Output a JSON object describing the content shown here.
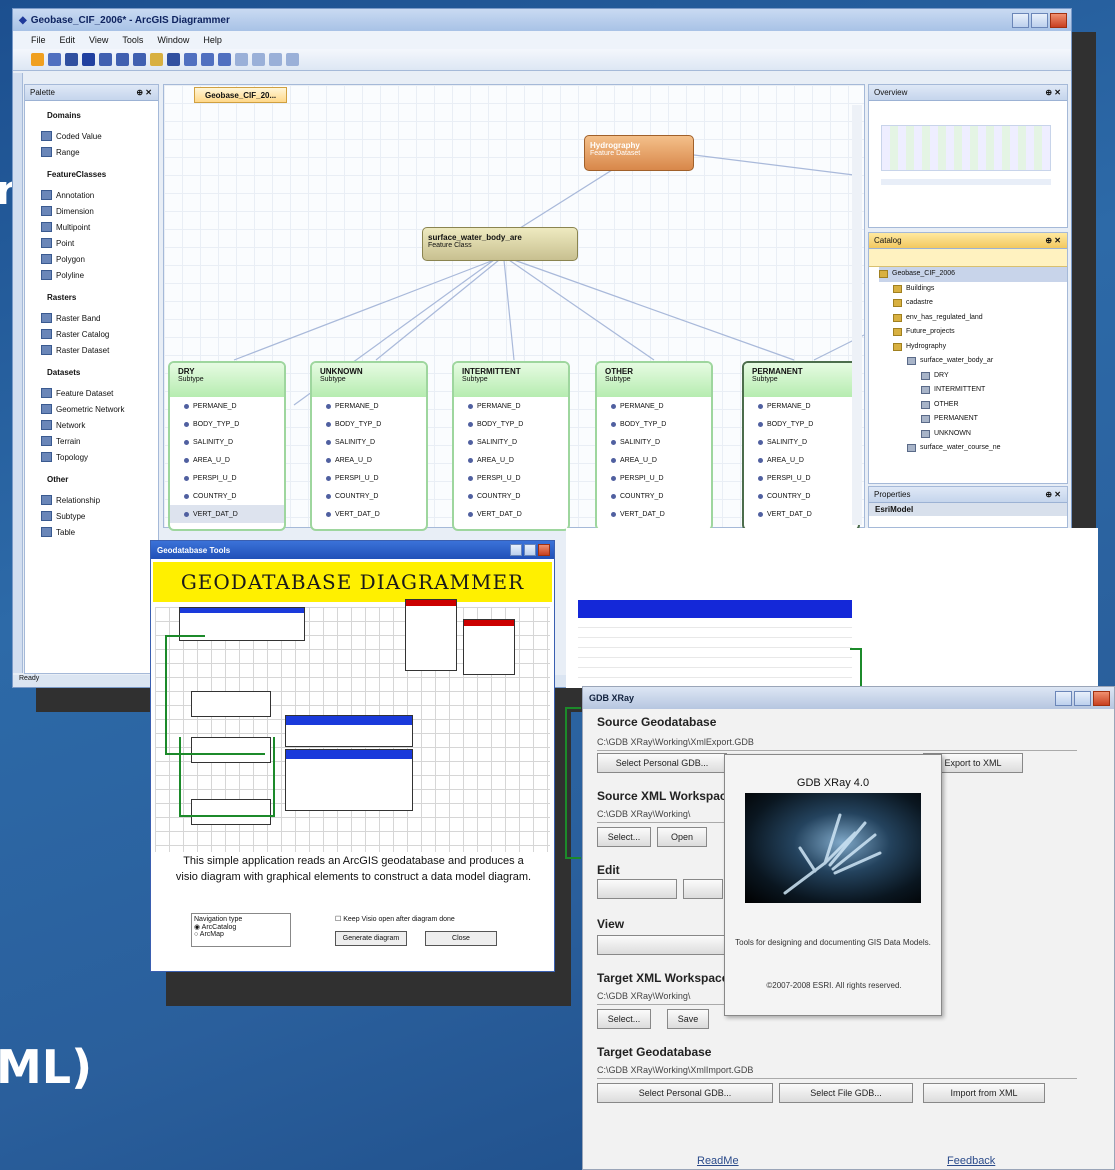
{
  "slide": {
    "left_text": "ML)",
    "edge_text": "r"
  },
  "diagrammer": {
    "title": "Geobase_CIF_2006* - ArcGIS Diagrammer",
    "menu": [
      "File",
      "Edit",
      "View",
      "Tools",
      "Window",
      "Help"
    ],
    "palette": {
      "header": "Palette",
      "sections": [
        {
          "title": "Domains",
          "items": [
            "Coded Value",
            "Range"
          ]
        },
        {
          "title": "FeatureClasses",
          "items": [
            "Annotation",
            "Dimension",
            "Multipoint",
            "Point",
            "Polygon",
            "Polyline"
          ]
        },
        {
          "title": "Rasters",
          "items": [
            "Raster Band",
            "Raster Catalog",
            "Raster Dataset"
          ]
        },
        {
          "title": "Datasets",
          "items": [
            "Feature Dataset",
            "Geometric Network",
            "Network",
            "Terrain",
            "Topology"
          ]
        },
        {
          "title": "Other",
          "items": [
            "Relationship",
            "Subtype",
            "Table"
          ]
        }
      ]
    },
    "doc_tab": "Geobase_CIF_20...",
    "nodes": {
      "hydrography": {
        "title": "Hydrography",
        "sub": "Feature Dataset"
      },
      "surface": {
        "title": "surface_water_body_are",
        "sub": "Feature Class"
      }
    },
    "subtypes": [
      {
        "title": "DRY",
        "sub": "Subtype"
      },
      {
        "title": "UNKNOWN",
        "sub": "Subtype"
      },
      {
        "title": "INTERMITTENT",
        "sub": "Subtype"
      },
      {
        "title": "OTHER",
        "sub": "Subtype"
      },
      {
        "title": "PERMANENT",
        "sub": "Subtype"
      }
    ],
    "fields": [
      "PERMANE_D",
      "BODY_TYP_D",
      "SALINITY_D",
      "AREA_U_D",
      "PERSPI_U_D",
      "COUNTRY_D",
      "VERT_DAT_D"
    ],
    "overview_header": "Overview",
    "catalog": {
      "header": "Catalog",
      "tree": [
        "Geobase_CIF_2006",
        "Buildings",
        "cadastre",
        "env_has_regulated_land",
        "Future_projects",
        "Hydrography",
        "surface_water_body_ar",
        "DRY",
        "INTERMITTENT",
        "OTHER",
        "PERMANENT",
        "UNKNOWN",
        "surface_water_course_ne"
      ]
    },
    "properties": {
      "header": "Properties",
      "row": "EsriModel"
    },
    "status": "Ready"
  },
  "tools": {
    "title": "Geodatabase Tools",
    "banner": "GEODATABASE DIAGRAMMER",
    "description": "This simple application reads an ArcGIS geodatabase and produces a visio diagram with graphical elements to construct a data model diagram.",
    "options_label": "Navigation type",
    "options": [
      "ArcCatalog",
      "ArcMap"
    ],
    "checkbox": "Keep Visio open after diagram done",
    "btn_generate": "Generate diagram",
    "btn_close": "Close"
  },
  "xray": {
    "title": "GDB XRay",
    "sections": {
      "source_gdb": "Source Geodatabase",
      "source_xml": "Source XML Workspace",
      "edit": "Edit",
      "view": "View",
      "target_xml": "Target XML Workspace",
      "target_gdb": "Target Geodatabase"
    },
    "paths": {
      "source_gdb": "C:\\GDB XRay\\Working\\XmlExport.GDB",
      "source_xml": "C:\\GDB XRay\\Working\\",
      "target_xml": "C:\\GDB XRay\\Working\\",
      "target_gdb": "C:\\GDB XRay\\Working\\XmlImport.GDB"
    },
    "buttons": {
      "select_personal": "Select Personal GDB...",
      "export_xml": "Export to XML",
      "select": "Select...",
      "open": "Open",
      "save": "Save",
      "select_file": "Select File GDB...",
      "import_xml": "Import from XML"
    },
    "links": {
      "readme": "ReadMe",
      "feedback": "Feedback"
    },
    "about": {
      "title": "GDB XRay 4.0",
      "desc": "Tools for designing and documenting GIS Data Models.",
      "copyright": "©2007-2008 ESRI. All rights reserved."
    }
  }
}
